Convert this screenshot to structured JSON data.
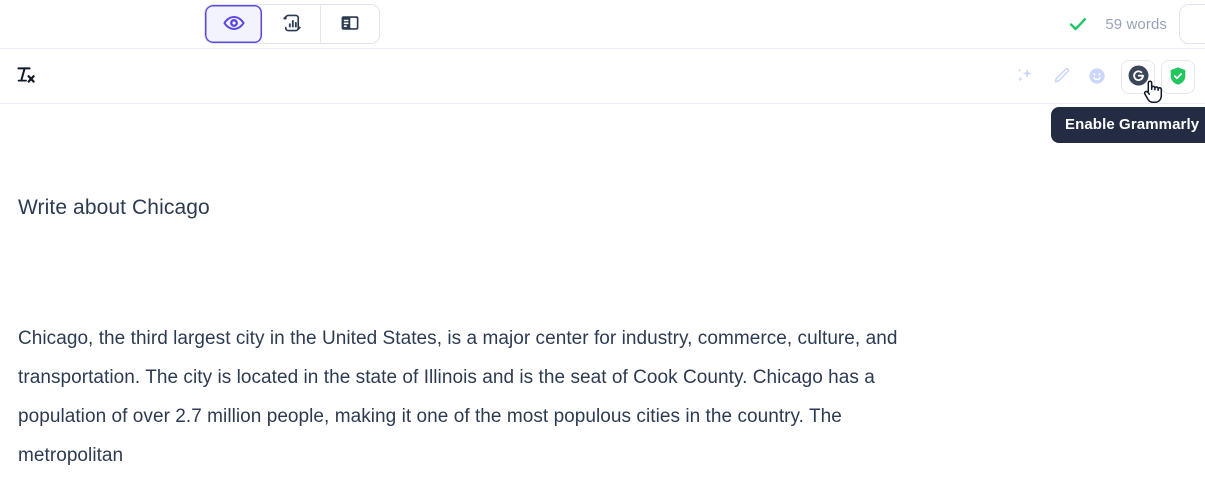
{
  "topbar": {
    "view_modes": [
      {
        "id": "preview",
        "icon": "eye-icon",
        "label": "Preview",
        "active": true
      },
      {
        "id": "analytics",
        "icon": "chart-refresh-icon",
        "label": "Analytics",
        "active": false
      },
      {
        "id": "split-view",
        "icon": "split-layout-icon",
        "label": "Split View",
        "active": false
      }
    ],
    "status": {
      "icon": "checkmark-icon",
      "icon_color": "#18c964",
      "word_count_label": "59 words"
    },
    "edge_button": {
      "icon": "cut-off-button",
      "label": ""
    }
  },
  "toolbar": {
    "clear_formatting": {
      "icon": "clear-formatting-icon",
      "label": "Tx"
    },
    "right_icons": [
      {
        "id": "sparkles",
        "icon": "sparkles-icon",
        "label": "AI Assist",
        "color": "#ccd6f8"
      },
      {
        "id": "pencil",
        "icon": "pencil-icon",
        "label": "Draw",
        "color": "#ccd6f8"
      },
      {
        "id": "emoji",
        "icon": "emoji-smiley-icon",
        "label": "Emoji",
        "color": "#ccd6f8"
      },
      {
        "id": "grammarly",
        "icon": "grammarly-logo-icon",
        "label": "Grammarly",
        "color": "#3c4659"
      },
      {
        "id": "shield",
        "icon": "shield-check-icon",
        "label": "Protected",
        "color": "#22c55e"
      }
    ]
  },
  "tooltip": {
    "text": "Enable Grammarly",
    "background": "#232c43",
    "color": "#ffffff"
  },
  "cursor": {
    "icon": "hand-pointer-cursor"
  },
  "document": {
    "title": "Write about Chicago",
    "paragraph": "Chicago, the third largest city in the United States, is a major center for industry, commerce, culture, and transportation. The city is located in the state of Illinois and is the seat of Cook County. Chicago has a population of over 2.7 million people, making it one of the most populous cities in the country. The metropolitan"
  },
  "colors": {
    "accent": "#5b4ae0",
    "text": "#2d3b52",
    "muted": "#9aa3b8",
    "border": "#e9ecf4",
    "green": "#22c55e",
    "tooltip_bg": "#232c43"
  }
}
